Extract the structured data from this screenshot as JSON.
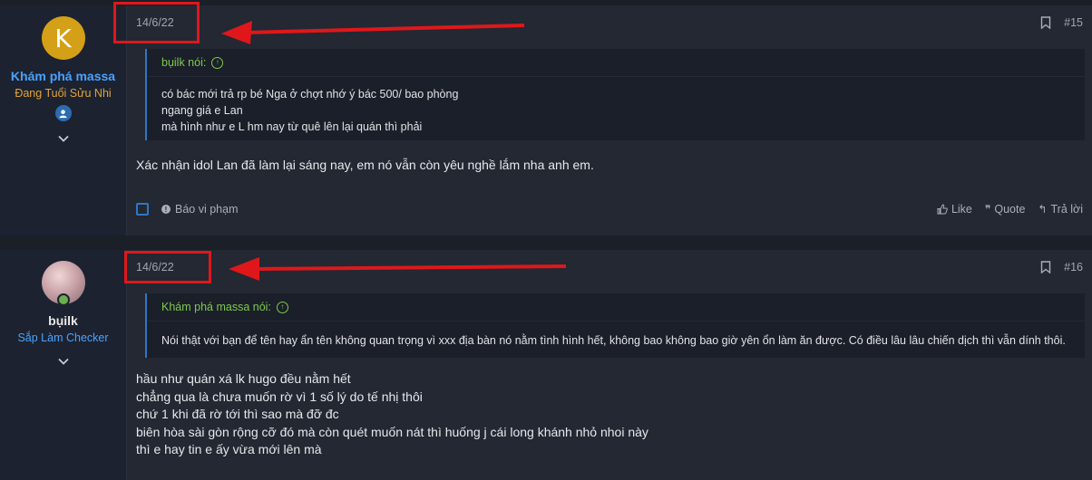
{
  "posts": [
    {
      "date": "14/6/22",
      "number": "#15",
      "user": {
        "name": "Khám phá massa",
        "title": "Đang Tuổi Sửu Nhi",
        "avatar_letter": "K"
      },
      "quote": {
        "author": "bụilk nói:",
        "lines": [
          "có bác mới trả rp bé Nga ở chợt nhớ ý bác 500/ bao phòng",
          "ngang giá e Lan",
          "mà hình như e L hm nay từ quê lên lại quán thì phải"
        ]
      },
      "message_lines": [
        "Xác nhận idol Lan đã làm lại sáng nay, em nó vẫn còn yêu nghề lắm nha anh em."
      ],
      "footer": {
        "report": "Báo vi phạm",
        "like": "Like",
        "quote": "Quote",
        "reply": "Trả lời"
      }
    },
    {
      "date": "14/6/22",
      "number": "#16",
      "user": {
        "name": "bụilk",
        "title": "Sắp Làm Checker"
      },
      "quote": {
        "author": "Khám phá massa nói:",
        "lines": [
          "Nói thật với bạn để tên hay ẩn tên không quan trọng vì xxx địa bàn nó nằm tình hình hết, không bao không bao giờ yên ổn làm ăn được. Có điều lâu lâu chiến dịch thì vẫn dính thôi."
        ]
      },
      "message_lines": [
        "hầu như quán xá lk hugo đều nằm hết",
        "chẳng qua là chưa muốn rờ vì 1 số lý do tế nhị thôi",
        "chứ 1 khi đã rờ tới thì sao mà đỡ đc",
        "biên hòa sài gòn rộng cỡ đó mà còn quét muốn nát thì huống j cái long khánh nhỏ nhoi này",
        "thì e hay tin e ấy vừa mới lên mà"
      ]
    }
  ],
  "colors": {
    "accent": "#2f76c7",
    "username_blue": "#48a2ff",
    "quote_author": "#7ec94d",
    "annotation_red": "#e0171a"
  },
  "icons": [
    "bookmark-icon",
    "chevron-down-icon",
    "up-arrow-circle-icon",
    "like-icon",
    "quote-icon",
    "reply-icon",
    "info-icon",
    "staff-badge-icon"
  ]
}
